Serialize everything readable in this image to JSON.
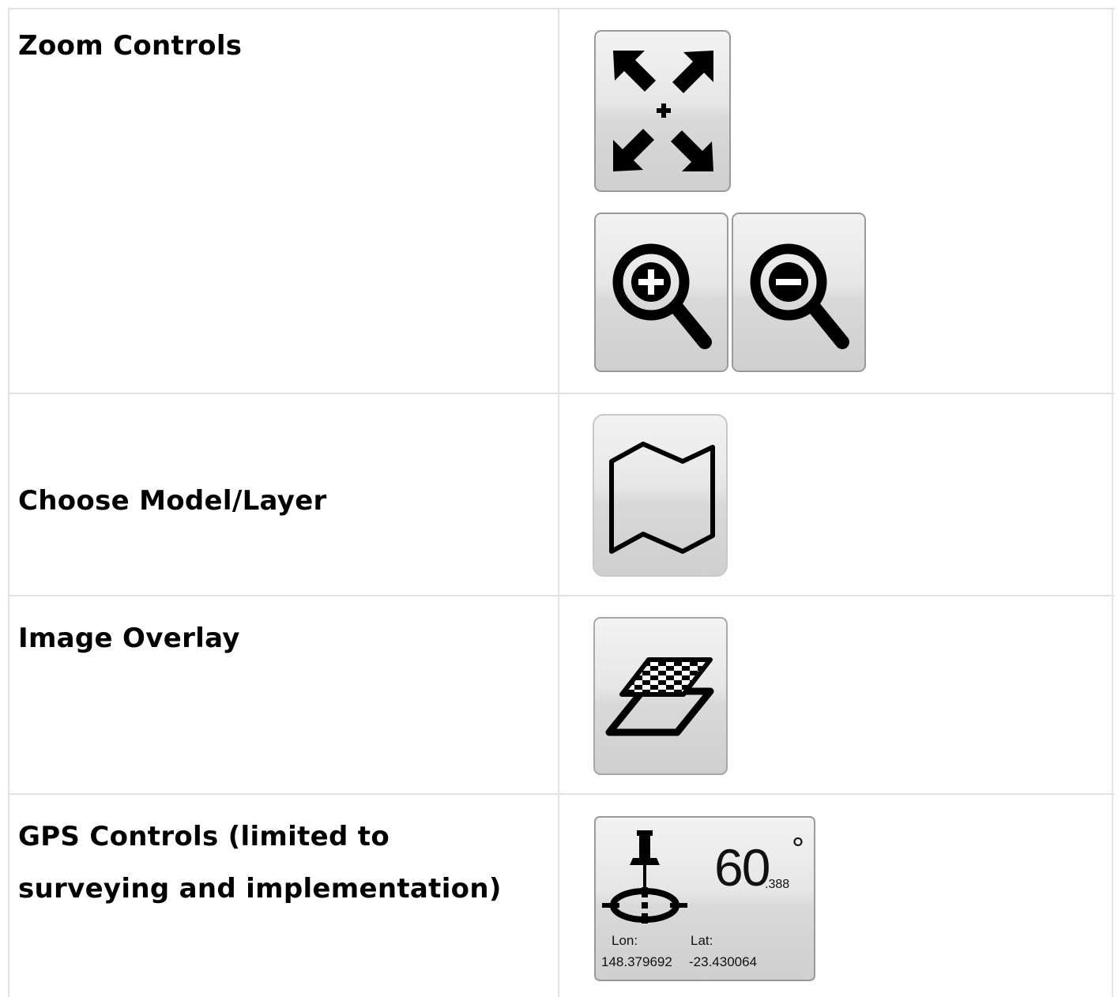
{
  "rows": [
    {
      "label": "Zoom Controls",
      "icons": [
        "zoom-extents-icon",
        "zoom-in-icon",
        "zoom-out-icon"
      ]
    },
    {
      "label": "Choose Model/Layer",
      "icons": [
        "map-icon"
      ]
    },
    {
      "label": "Image Overlay",
      "icons": [
        "image-overlay-icon"
      ]
    },
    {
      "label_line1": "GPS Controls (limited to",
      "label_line2": "surveying and implementation)",
      "icons": [
        "gps-pin-icon",
        "crosshair-icon"
      ]
    }
  ],
  "gps": {
    "heading_main": "60",
    "heading_fraction": ".388",
    "degree_symbol": "°",
    "lon_label": "Lon:",
    "lat_label": "Lat:",
    "lon_value": "148.379692",
    "lat_value": "-23.430064"
  }
}
